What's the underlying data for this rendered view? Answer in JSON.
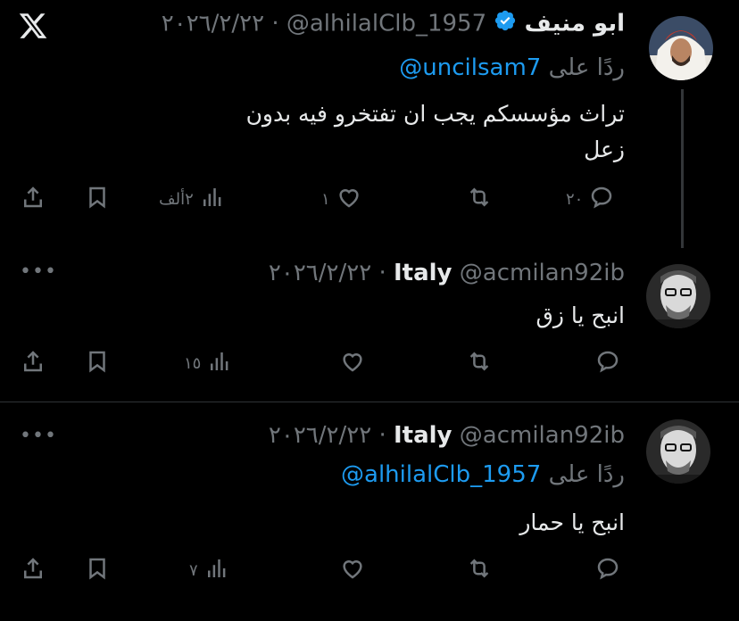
{
  "tweets": [
    {
      "name": "ابو منيف",
      "handle": "@alhilalClb_1957",
      "date": "٢٠٢٦/٢/٢٢",
      "reply_prefix": "ردًا على",
      "reply_to": "@uncilsam7",
      "text_line1": "تراث مؤسسكم يجب ان تفتخرو فيه بدون",
      "text_line2": "زعل",
      "replies": "٢٠",
      "likes": "١",
      "views": "٢ألف",
      "verified": true
    },
    {
      "name": "Italy",
      "handle": "@acmilan92ib",
      "date": "٢٠٢٦/٢/٢٢",
      "text_line1": "انبح يا زق",
      "views": "١٥"
    },
    {
      "name": "Italy",
      "handle": "@acmilan92ib",
      "date": "٢٠٢٦/٢/٢٢",
      "reply_prefix": "ردًا على",
      "reply_to": "@alhilalClb_1957",
      "text_line1": "انبح يا حمار",
      "views": "٧"
    }
  ],
  "colors": {
    "background": "#000000",
    "text": "#e7e9ea",
    "muted": "#71767b",
    "link": "#1d9bf0",
    "separator": "#2f3336"
  },
  "icons": [
    "x-logo-icon",
    "verified-badge-icon",
    "reply-icon",
    "retweet-icon",
    "like-icon",
    "views-icon",
    "bookmark-icon",
    "share-icon",
    "more-icon"
  ]
}
